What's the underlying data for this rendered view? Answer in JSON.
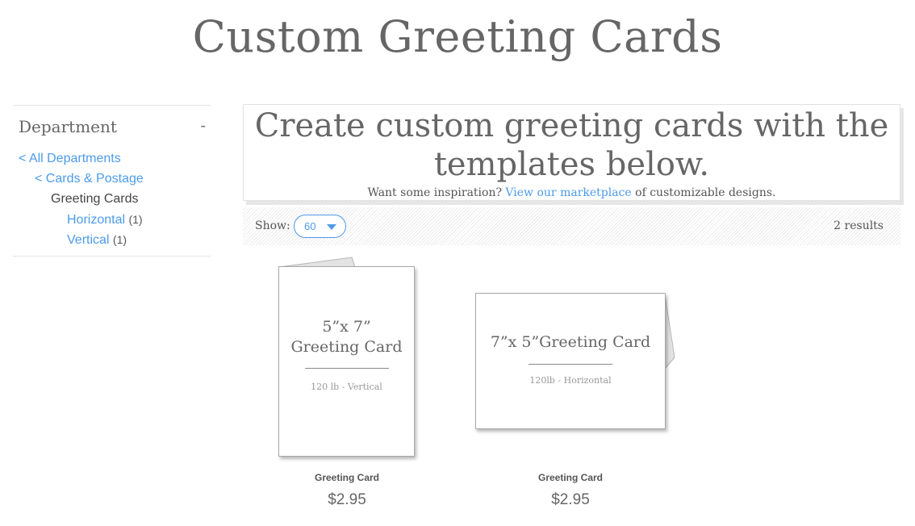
{
  "page": {
    "title": "Custom Greeting Cards"
  },
  "sidebar": {
    "heading": "Department",
    "toggle": "-",
    "items": [
      {
        "label": "< All Departments",
        "link": true,
        "level": 1
      },
      {
        "label": "< Cards & Postage",
        "link": true,
        "level": 2
      },
      {
        "label": "Greeting Cards",
        "link": false,
        "level": 3
      },
      {
        "label": "Horizontal",
        "count": "(1)",
        "link": true,
        "level": 4
      },
      {
        "label": "Vertical",
        "count": "(1)",
        "link": true,
        "level": 4
      }
    ]
  },
  "banner": {
    "headline_line1": "Create custom greeting cards with the",
    "headline_line2": "templates below.",
    "sub_prefix": "Want some inspiration? ",
    "sub_link": "View our marketplace",
    "sub_suffix": " of customizable designs."
  },
  "toolbar": {
    "show_label": "Show:",
    "show_value": "60",
    "results": "2 results"
  },
  "products": [
    {
      "name": "Greeting Card",
      "price": "$2.95",
      "thumb_title_line1": "5”x 7”",
      "thumb_title_line2": "Greeting Card",
      "thumb_sub": "120 lb - Vertical"
    },
    {
      "name": "Greeting Card",
      "price": "$2.95",
      "thumb_title_line1": "7”x 5”Greeting Card",
      "thumb_sub": "120lb - Horizontal"
    }
  ],
  "colors": {
    "link": "#4d9be9",
    "text": "#555555",
    "heading": "#666666"
  }
}
